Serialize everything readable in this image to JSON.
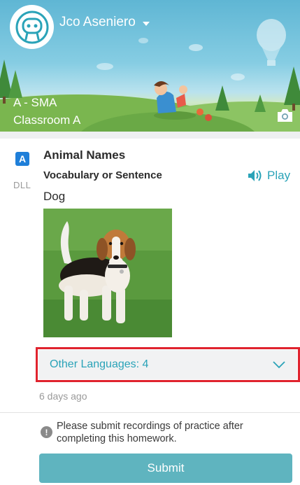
{
  "header": {
    "user_name": "Jco Aseniero",
    "class_code": "A - SMA",
    "classroom": "Classroom A"
  },
  "activity": {
    "type_badge": "A",
    "type_label": "DLL",
    "title": "Animal Names",
    "subtitle": "Vocabulary or Sentence",
    "word": "Dog",
    "play_label": "Play",
    "image": "beagle-dog-photo"
  },
  "other_languages": {
    "label": "Other Languages: 4"
  },
  "timestamp": "6 days ago",
  "notice": "Please submit recordings of practice after completing this homework.",
  "submit_label": "Submit",
  "colors": {
    "accent": "#2aa3b8",
    "submit": "#5fb4bf",
    "highlight": "#e0232e"
  }
}
